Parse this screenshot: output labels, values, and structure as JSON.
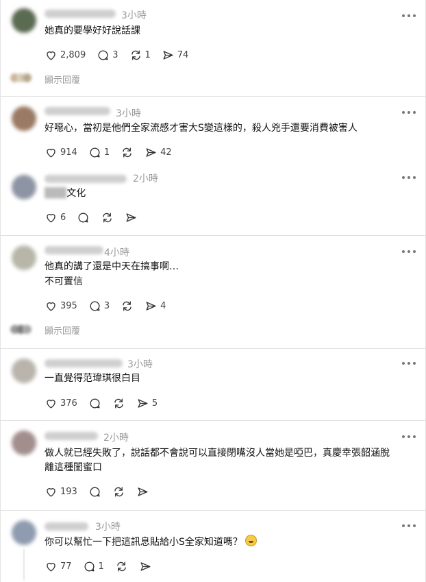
{
  "comments": [
    {
      "time": "3小時",
      "text": "她真的要學好好說話課",
      "likes": "2,809",
      "replies": "3",
      "reposts": "1",
      "shares": "74",
      "show_replies": "顯示回覆"
    },
    {
      "time": "3小時",
      "text": "好噁心，當初是他們全家流感才害大S變這樣的，殺人兇手還要消費被害人",
      "likes": "914",
      "replies": "1",
      "reposts": "",
      "shares": "42"
    },
    {
      "time": "2小時",
      "text_visible": "文化",
      "likes": "6",
      "replies": "",
      "reposts": "",
      "shares": ""
    },
    {
      "time": "4小時",
      "text_line1": "他真的講了還是中天在搞事啊…",
      "text_line2": "不可置信",
      "likes": "395",
      "replies": "3",
      "reposts": "",
      "shares": "4",
      "show_replies": "顯示回覆"
    },
    {
      "time": "3小時",
      "text": "一直覺得范瑋琪很白目",
      "likes": "376",
      "replies": "",
      "reposts": "",
      "shares": "5"
    },
    {
      "time": "2小時",
      "text_line1": "做人就已經失敗了，說話都不會說可以直接閉嘴沒人當她是啞巴，真慶幸張韶涵脫",
      "text_line2": "離這種閨蜜口",
      "likes": "193",
      "replies": "",
      "reposts": "",
      "shares": ""
    },
    {
      "time": "3小時",
      "text": "你可以幫忙一下把這訊息貼給小S全家知道嗎？",
      "likes": "77",
      "replies": "1",
      "reposts": "",
      "shares": ""
    }
  ],
  "icons": {
    "like": "heart-icon",
    "reply": "comment-icon",
    "repost": "repost-icon",
    "share": "send-icon",
    "more": "more-dots-icon",
    "emoji": "rolling-laughing-emoji-icon"
  }
}
